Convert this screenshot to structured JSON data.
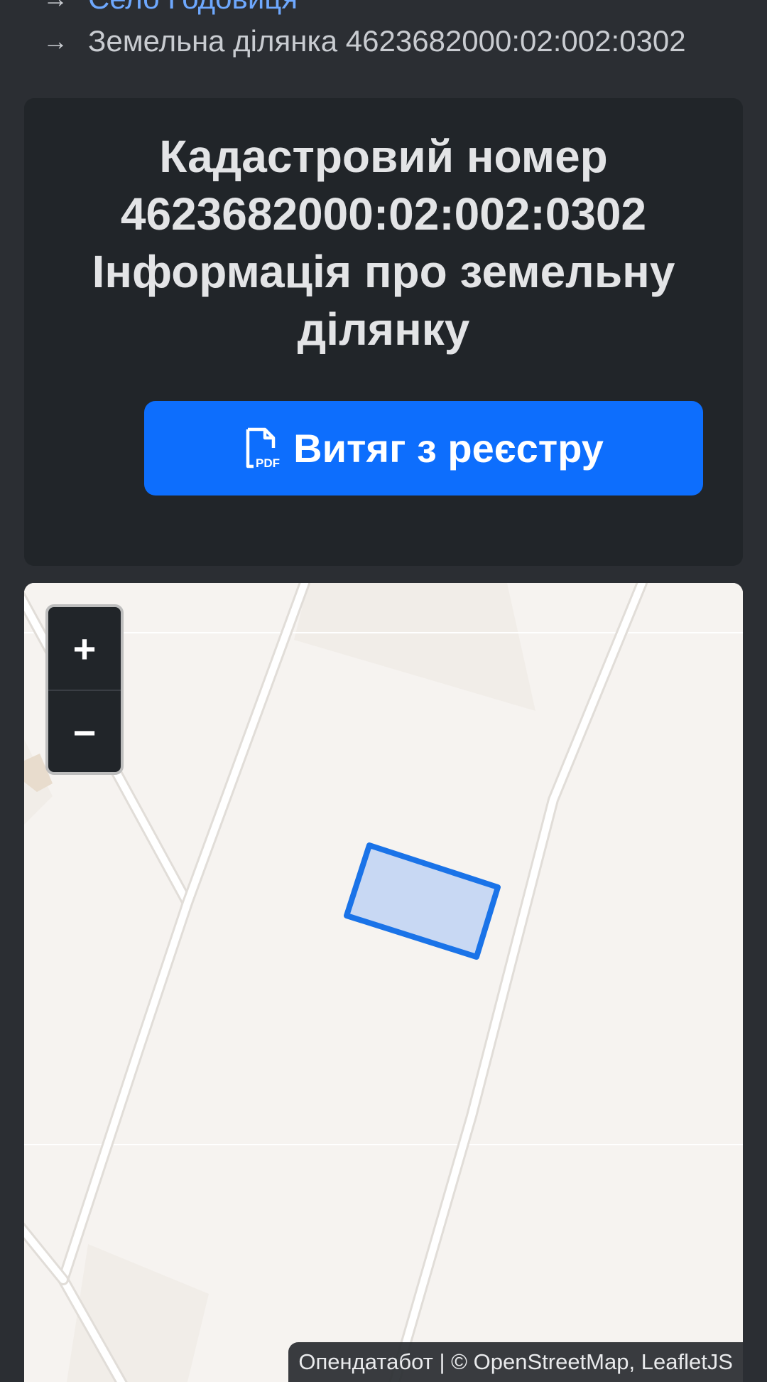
{
  "breadcrumb": {
    "items": [
      {
        "arrow": "→",
        "label": "Село Годовиця"
      },
      {
        "arrow": "→",
        "label": "Земельна ділянка 4623682000:02:002:0302"
      }
    ]
  },
  "header": {
    "title_line1": "Кадастровий номер",
    "title_line2": "4623682000:02:002:0302",
    "title_line3": "Інформація про земельну",
    "title_line4": "ділянку",
    "extract_button_label": "Витяг з реєстру",
    "extract_button_icon": "pdf-file-icon"
  },
  "map": {
    "zoom_in_label": "+",
    "zoom_out_label": "−",
    "parcel_fill": "#c8d8f3",
    "parcel_stroke": "#1a73e8",
    "attribution": {
      "owner": "Опендатабот",
      "separator": "|",
      "osm": "© OpenStreetMap",
      "comma": ",",
      "leaflet": "LeafletJS"
    }
  },
  "colors": {
    "background": "#2b2e33",
    "card": "#212529",
    "accent": "#0d6efd",
    "link": "#6ea8fe"
  }
}
